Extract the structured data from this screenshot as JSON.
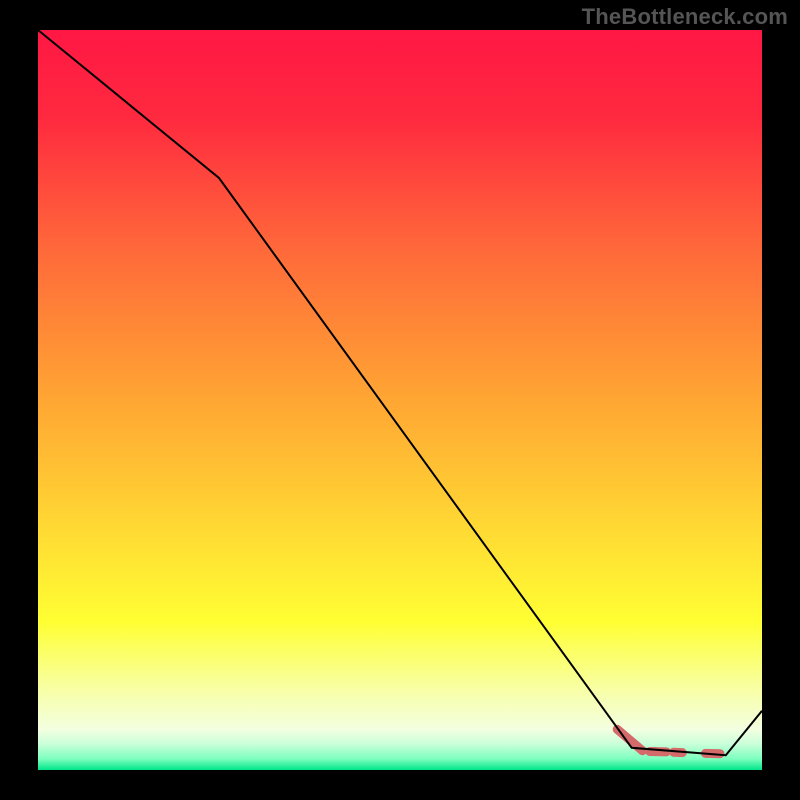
{
  "watermark": "TheBottleneck.com",
  "chart_data": {
    "type": "line",
    "title": "",
    "xlabel": "",
    "ylabel": "",
    "x_range": [
      0,
      100
    ],
    "y_range": [
      0,
      100
    ],
    "background_gradient": {
      "stops": [
        {
          "offset": 0.0,
          "color": "#ff1744"
        },
        {
          "offset": 0.12,
          "color": "#ff2a3f"
        },
        {
          "offset": 0.3,
          "color": "#ff6a3a"
        },
        {
          "offset": 0.5,
          "color": "#ffa633"
        },
        {
          "offset": 0.65,
          "color": "#ffd233"
        },
        {
          "offset": 0.8,
          "color": "#ffff33"
        },
        {
          "offset": 0.9,
          "color": "#f7ffb0"
        },
        {
          "offset": 0.945,
          "color": "#f3ffe0"
        },
        {
          "offset": 0.965,
          "color": "#c9ffd9"
        },
        {
          "offset": 0.985,
          "color": "#7dffbf"
        },
        {
          "offset": 1.0,
          "color": "#00e58a"
        }
      ]
    },
    "series": [
      {
        "name": "main-line",
        "color": "#000000",
        "width": 2,
        "points": [
          {
            "x": 0,
            "y": 100
          },
          {
            "x": 25,
            "y": 80
          },
          {
            "x": 82,
            "y": 3
          },
          {
            "x": 95,
            "y": 2
          },
          {
            "x": 100,
            "y": 8
          }
        ]
      }
    ],
    "highlight_segments": [
      {
        "name": "highlight-dash",
        "color": "#d46a6a",
        "width": 9,
        "linecap": "round",
        "segments": [
          [
            {
              "x": 80,
              "y": 5.5
            },
            {
              "x": 83.5,
              "y": 2.6
            }
          ],
          [
            {
              "x": 84.5,
              "y": 2.5
            },
            {
              "x": 86.8,
              "y": 2.45
            }
          ],
          [
            {
              "x": 87.8,
              "y": 2.4
            },
            {
              "x": 89.0,
              "y": 2.35
            }
          ],
          [
            {
              "x": 92.2,
              "y": 2.25
            },
            {
              "x": 94.2,
              "y": 2.2
            }
          ]
        ]
      }
    ]
  }
}
